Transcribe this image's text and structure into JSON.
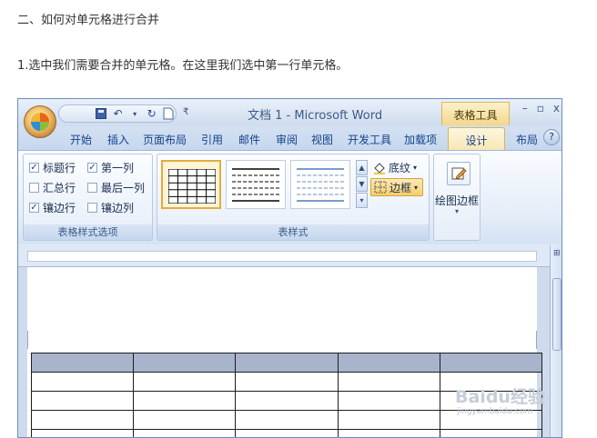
{
  "article": {
    "heading": "二、如何对单元格进行合并",
    "step": "1.选中我们需要合并的单元格。在这里我们选中第一行单元格。"
  },
  "window": {
    "title": "文档 1 - Microsoft Word",
    "context_header": "表格工具",
    "controls": [
      "–",
      "▫",
      "x"
    ]
  },
  "qat": {
    "undo": "↶",
    "redo": "↻",
    "customize": "₹"
  },
  "tabs": [
    "开始",
    "插入",
    "页面布局",
    "引用",
    "邮件",
    "审阅",
    "视图",
    "开发工具",
    "加载项"
  ],
  "active_tab": "设计",
  "extra_tab": "布局",
  "help": "?",
  "ribbon": {
    "options_group": {
      "label": "表格样式选项",
      "items": [
        {
          "label": "标题行",
          "checked": true
        },
        {
          "label": "第一列",
          "checked": true
        },
        {
          "label": "汇总行",
          "checked": false
        },
        {
          "label": "最后一列",
          "checked": false
        },
        {
          "label": "镶边行",
          "checked": true
        },
        {
          "label": "镶边列",
          "checked": false
        }
      ]
    },
    "styles_group": {
      "label": "表样式",
      "shading": "底纹",
      "borders": "边框"
    },
    "draw_borders": {
      "label": "绘图边框"
    }
  },
  "table": {
    "rows": 5,
    "cols": 5,
    "selected_row": 1
  },
  "watermark": {
    "logo": "Baidu经验",
    "url": "jingyan.baidu.com"
  },
  "colors": {
    "selected_cells": "#a8b3cc",
    "ribbon_accent": "#15428b",
    "context_tab": "#f7e7b4"
  }
}
